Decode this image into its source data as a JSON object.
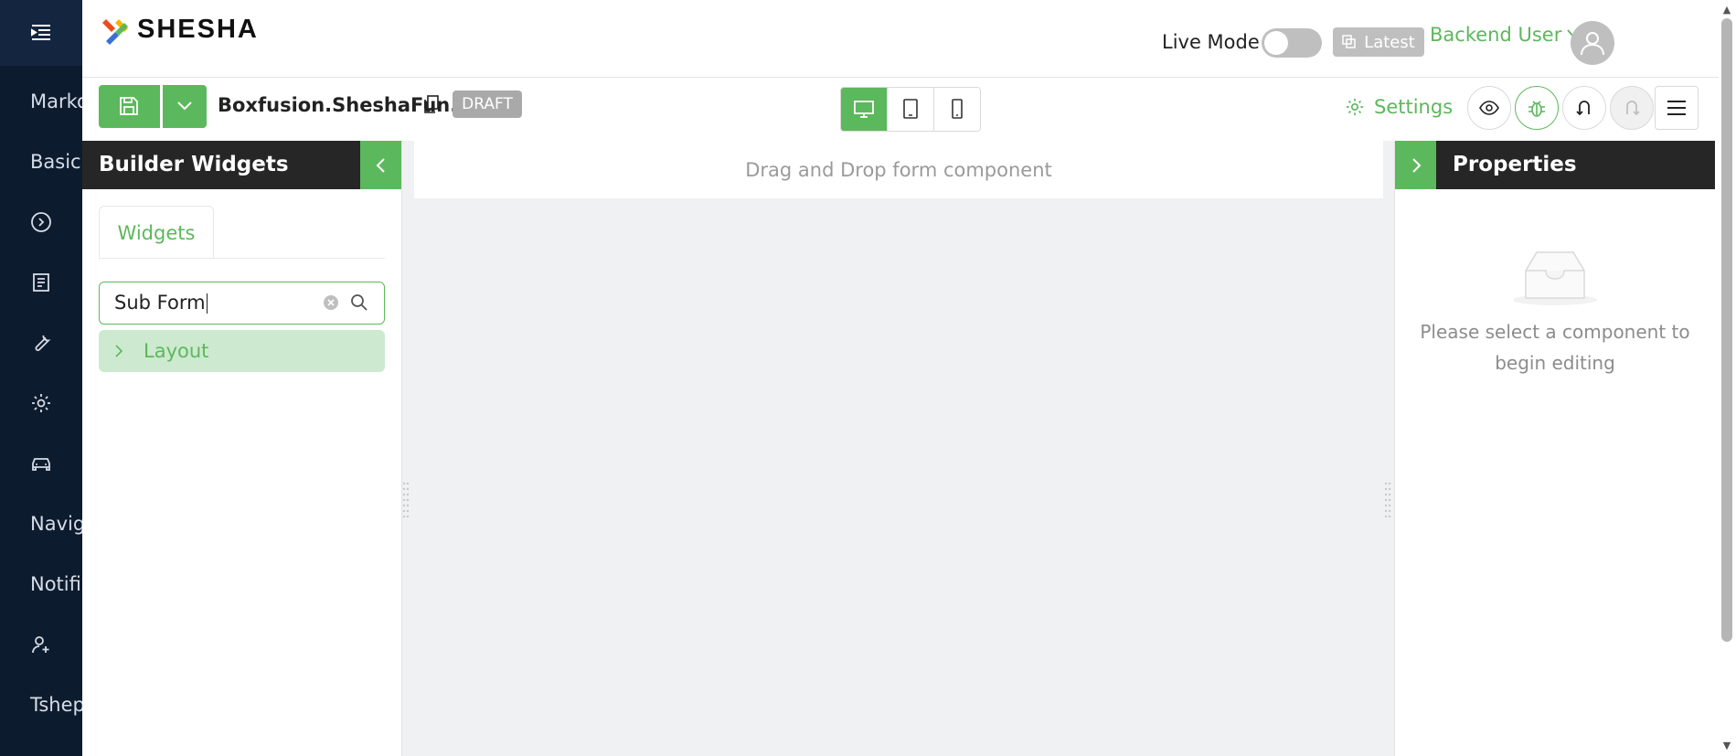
{
  "nav": {
    "items": [
      {
        "label": "Marko",
        "icon": ""
      },
      {
        "label": "Basic",
        "icon": ""
      },
      {
        "label": "",
        "icon": "play-circle-icon"
      },
      {
        "label": "",
        "icon": "document-icon"
      },
      {
        "label": "",
        "icon": "wrench-icon"
      },
      {
        "label": "",
        "icon": "gear-icon"
      },
      {
        "label": "",
        "icon": "car-icon"
      },
      {
        "label": "Navig",
        "icon": ""
      },
      {
        "label": "Notifi",
        "icon": ""
      },
      {
        "label": "",
        "icon": "user-add-icon"
      },
      {
        "label": "Tshep",
        "icon": ""
      }
    ]
  },
  "header": {
    "logo_text": "SHESHA",
    "live_mode_label": "Live Mode",
    "live_mode_on": false,
    "version_label": "Latest",
    "user_name": "Backend User"
  },
  "toolbar": {
    "form_name": "Boxfusion.SheshaFun...",
    "status_badge": "DRAFT",
    "selected_device": "desktop",
    "settings_label": "Settings"
  },
  "widgets_panel": {
    "title": "Builder Widgets",
    "tab_label": "Widgets",
    "search_value": "Sub Form",
    "groups": [
      {
        "label": "Layout"
      }
    ]
  },
  "canvas": {
    "drop_hint": "Drag and Drop form component"
  },
  "properties_panel": {
    "title": "Properties",
    "empty_text": "Please select a component to begin editing"
  },
  "colors": {
    "accent": "#5cb85c",
    "nav_bg": "#0d1b2e",
    "panel_head_bg": "#262626",
    "canvas_bg": "#f0f1f3"
  }
}
